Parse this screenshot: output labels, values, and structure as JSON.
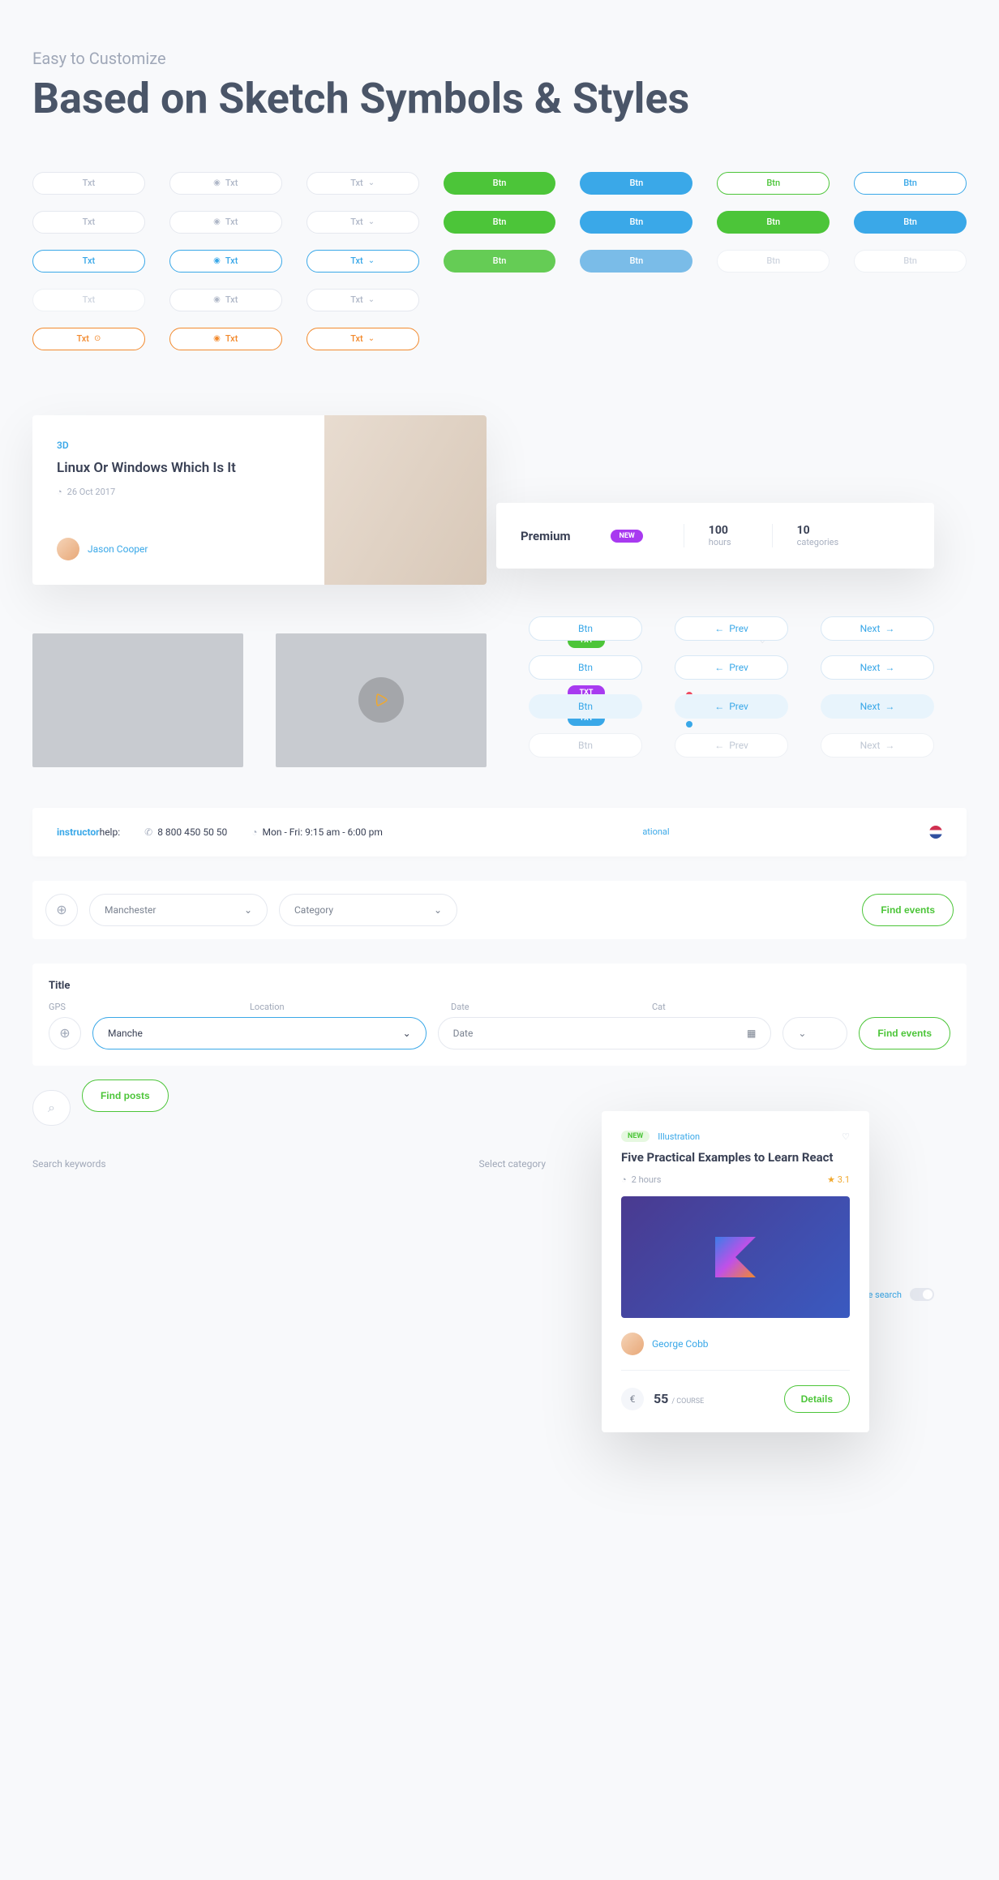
{
  "header": {
    "subtitle": "Easy to Customize",
    "title": "Based on Sketch Symbols & Styles"
  },
  "pills": {
    "txt": "Txt",
    "btn": "Btn",
    "prev": "Prev",
    "next": "Next"
  },
  "premium": {
    "title": "Premium",
    "badge": "NEW",
    "stat1_num": "100",
    "stat1_lbl": "hours",
    "stat2_num": "10",
    "stat2_lbl": "categories"
  },
  "article": {
    "category": "3D",
    "title": "Linux Or Windows Which Is It",
    "date": "26 Oct 2017",
    "author": "Jason Cooper"
  },
  "tags": {
    "txt": "TXT"
  },
  "infobar": {
    "logo_a": "instructor",
    "logo_b": "help:",
    "phone": "8 800  450 50 50",
    "hours": "Mon - Fri: 9:15 am - 6:00 pm",
    "lang": "ational"
  },
  "search1": {
    "city": "Manchester",
    "category": "Category",
    "find": "Find events"
  },
  "form": {
    "title": "Title",
    "gps": "GPS",
    "location_lbl": "Location",
    "location": "Manche",
    "date_lbl": "Date",
    "date_ph": "Date",
    "cat_lbl": "Cat",
    "find": "Find events",
    "advance": "nce search"
  },
  "course": {
    "badge": "NEW",
    "category": "Illustration",
    "title": "Five Practical Examples to Learn React",
    "duration": "2 hours",
    "rating": "3.1",
    "author": "George Cobb",
    "price": "55",
    "price_unit": "/ COURSE",
    "details": "Details"
  },
  "bottom": {
    "find_posts": "Find posts",
    "search_kw": "Search keywords",
    "select_cat": "Select category"
  }
}
